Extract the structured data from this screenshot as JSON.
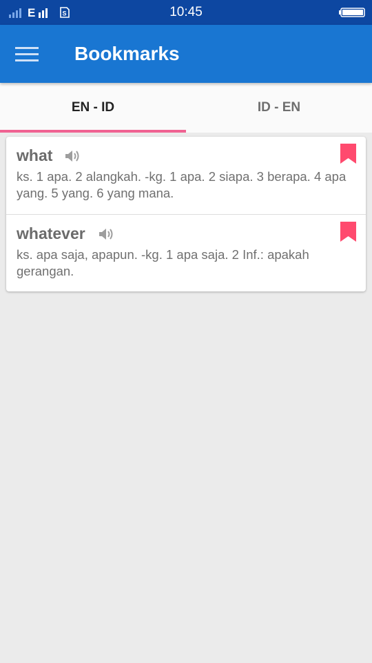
{
  "status_bar": {
    "network_type": "E",
    "time": "10:45"
  },
  "app_bar": {
    "title": "Bookmarks"
  },
  "tabs": [
    {
      "label": "EN - ID",
      "selected": true
    },
    {
      "label": "ID - EN",
      "selected": false
    }
  ],
  "bookmarks": [
    {
      "word": "what",
      "definition": "ks. 1 apa. 2 alangkah. -kg. 1 apa. 2 siapa. 3 berapa. 4 apa yang. 5 yang. 6 yang mana.",
      "bookmarked": true
    },
    {
      "word": "whatever",
      "definition": "ks. apa saja, apapun. -kg. 1 apa saja. 2 Inf.: apakah gerangan.",
      "bookmarked": true
    }
  ],
  "colors": {
    "status_bar": "#0d47a1",
    "app_bar": "#1976d2",
    "tab_indicator": "#f06292",
    "bookmark": "#ff4a6e",
    "background": "#ebebeb"
  },
  "icons": {
    "menu": "hamburger-menu-icon",
    "speaker": "speaker-icon",
    "bookmark": "bookmark-icon",
    "signal": "signal-strength-icon",
    "sim": "sim-card-icon",
    "battery": "battery-icon"
  }
}
